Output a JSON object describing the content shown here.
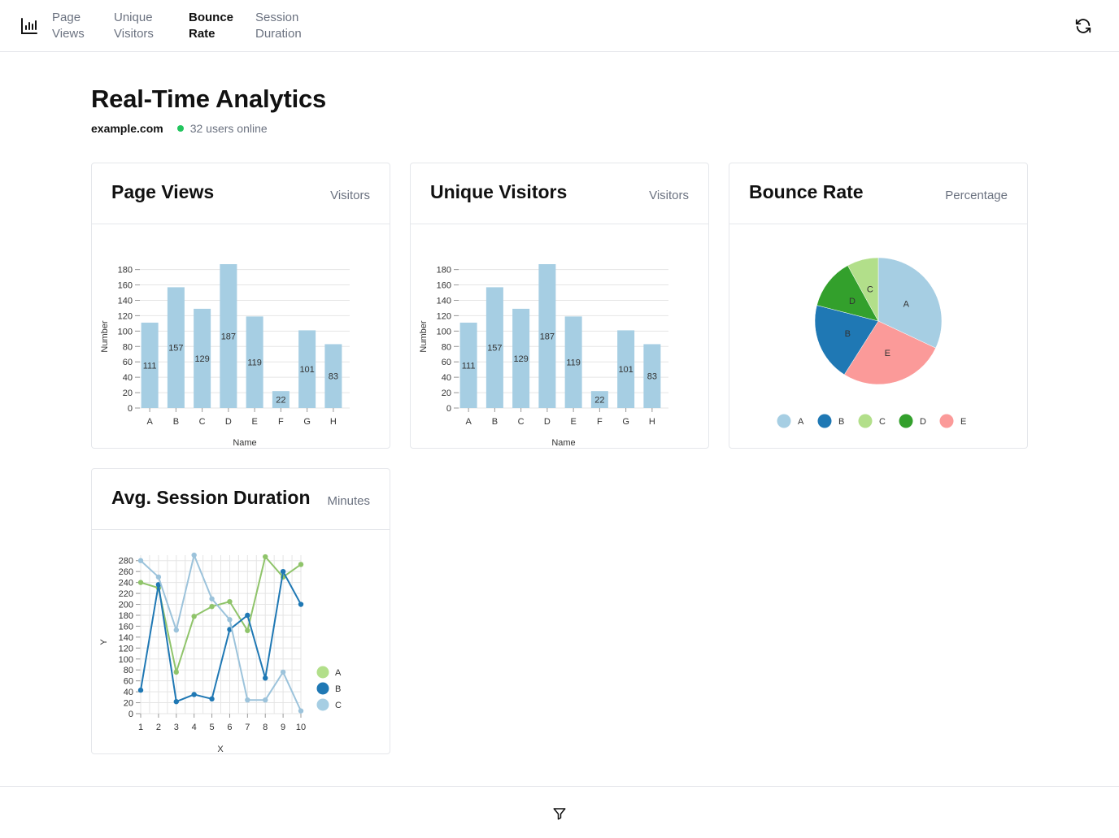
{
  "nav": {
    "tabs": [
      {
        "label_line1": "Page",
        "label_line2": "Views",
        "active": false
      },
      {
        "label_line1": "Unique",
        "label_line2": "Visitors",
        "active": false
      },
      {
        "label_line1": "Bounce",
        "label_line2": "Rate",
        "active": true
      },
      {
        "label_line1": "Session",
        "label_line2": "Duration",
        "active": false
      }
    ],
    "logo_icon": "bar-chart-icon",
    "refresh_icon": "refresh-icon"
  },
  "header": {
    "title": "Real-Time Analytics",
    "domain": "example.com",
    "online_text": "32 users online",
    "online_color": "#22c55e"
  },
  "cards": {
    "page_views": {
      "title": "Page Views",
      "unit": "Visitors"
    },
    "unique_visitors": {
      "title": "Unique Visitors",
      "unit": "Visitors"
    },
    "bounce_rate": {
      "title": "Bounce Rate",
      "unit": "Percentage"
    },
    "session_duration": {
      "title": "Avg. Session Duration",
      "unit": "Minutes"
    }
  },
  "chart_data": [
    {
      "id": "page_views",
      "type": "bar",
      "categories": [
        "A",
        "B",
        "C",
        "D",
        "E",
        "F",
        "G",
        "H"
      ],
      "values": [
        111,
        157,
        129,
        187,
        119,
        22,
        101,
        83
      ],
      "xlabel": "Name",
      "ylabel": "Number",
      "yticks": [
        0,
        20,
        40,
        60,
        80,
        100,
        120,
        140,
        160,
        180
      ],
      "ylim": [
        0,
        187
      ],
      "grid": true,
      "color": "#a6cee3"
    },
    {
      "id": "unique_visitors",
      "type": "bar",
      "categories": [
        "A",
        "B",
        "C",
        "D",
        "E",
        "F",
        "G",
        "H"
      ],
      "values": [
        111,
        157,
        129,
        187,
        119,
        22,
        101,
        83
      ],
      "xlabel": "Name",
      "ylabel": "Number",
      "yticks": [
        0,
        20,
        40,
        60,
        80,
        100,
        120,
        140,
        160,
        180
      ],
      "ylim": [
        0,
        187
      ],
      "grid": true,
      "color": "#a6cee3"
    },
    {
      "id": "bounce_rate",
      "type": "pie",
      "slices": [
        {
          "label": "A",
          "value": 32,
          "color": "#a6cee3"
        },
        {
          "label": "E",
          "value": 27,
          "color": "#fb9a99"
        },
        {
          "label": "B",
          "value": 20,
          "color": "#1f78b4"
        },
        {
          "label": "D",
          "value": 13,
          "color": "#33a02c"
        },
        {
          "label": "C",
          "value": 8,
          "color": "#b2df8a"
        }
      ],
      "legend": [
        "A",
        "B",
        "C",
        "D",
        "E"
      ],
      "legend_placement": "bottom"
    },
    {
      "id": "session_duration",
      "type": "line",
      "x": [
        1,
        2,
        3,
        4,
        5,
        6,
        7,
        8,
        9,
        10
      ],
      "xlabel": "X",
      "ylabel": "Y",
      "yticks": [
        0,
        20,
        40,
        60,
        80,
        100,
        120,
        140,
        160,
        180,
        200,
        220,
        240,
        260,
        280
      ],
      "ylim": [
        0,
        290
      ],
      "grid": true,
      "legend_placement": "right",
      "series": [
        {
          "name": "A",
          "color": "#b2df8a",
          "stroke": "#8fc46a",
          "values": [
            240,
            230,
            76,
            178,
            196,
            205,
            152,
            287,
            250,
            273
          ]
        },
        {
          "name": "B",
          "color": "#1f78b4",
          "stroke": "#1f78b4",
          "values": [
            43,
            236,
            22,
            35,
            27,
            154,
            180,
            65,
            260,
            200
          ]
        },
        {
          "name": "C",
          "color": "#a6cee3",
          "stroke": "#9cc3db",
          "values": [
            280,
            250,
            153,
            290,
            210,
            172,
            25,
            25,
            76,
            5
          ]
        }
      ]
    }
  ],
  "bottom": {
    "filter_icon": "filter-icon"
  }
}
